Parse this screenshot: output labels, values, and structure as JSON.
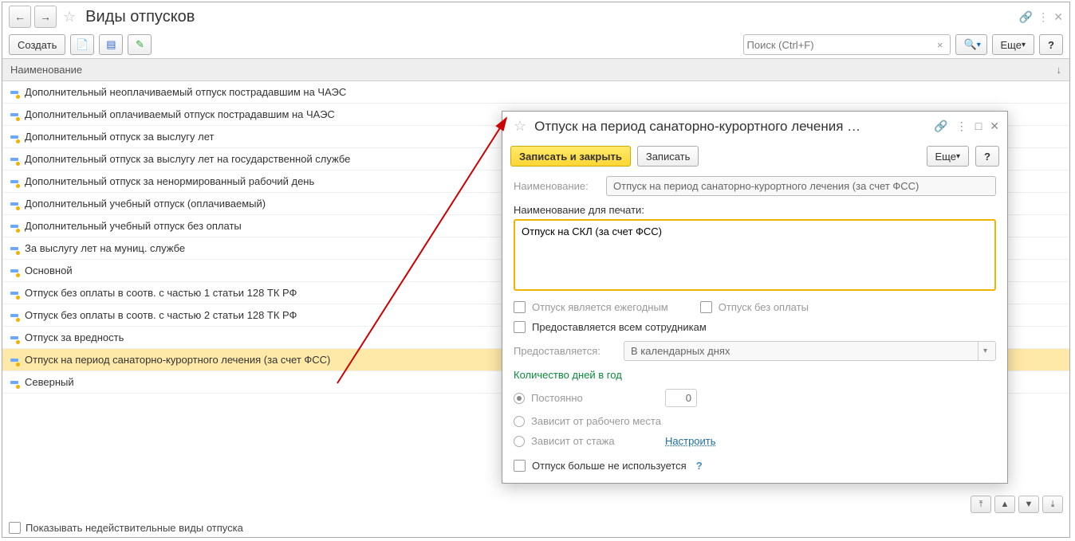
{
  "header": {
    "title": "Виды отпусков"
  },
  "toolbar": {
    "create": "Создать",
    "more": "Еще",
    "help": "?"
  },
  "search": {
    "placeholder": "Поиск (Ctrl+F)"
  },
  "table": {
    "header": "Наименование"
  },
  "list": [
    "Дополнительный неоплачиваемый отпуск пострадавшим на ЧАЭС",
    "Дополнительный оплачиваемый отпуск пострадавшим на ЧАЭС",
    "Дополнительный отпуск за выслугу лет",
    "Дополнительный отпуск за выслугу лет на государственной службе",
    "Дополнительный отпуск за ненормированный рабочий день",
    "Дополнительный учебный отпуск (оплачиваемый)",
    "Дополнительный учебный отпуск без оплаты",
    "За выслугу лет на муниц. службе",
    "Основной",
    "Отпуск без оплаты в соотв. с частью 1 статьи 128 ТК РФ",
    "Отпуск без оплаты в соотв. с частью 2 статьи 128 ТК РФ",
    "Отпуск за вредность",
    "Отпуск на период санаторно-курортного лечения (за счет ФСС)",
    "Северный"
  ],
  "selected_index": 12,
  "footer": {
    "show_inactive": "Показывать недействительные виды отпуска"
  },
  "dialog": {
    "title": "Отпуск на период санаторно-курортного лечения …",
    "save_close": "Записать и закрыть",
    "save": "Записать",
    "more": "Еще",
    "help": "?",
    "name_label": "Наименование:",
    "name_value": "Отпуск на период санаторно-курортного лечения (за счет ФСС)",
    "print_name_label": "Наименование для печати:",
    "print_name_value": "Отпуск на СКЛ (за счет ФСС)",
    "is_annual": "Отпуск является ежегодным",
    "no_pay": "Отпуск без оплаты",
    "all_employees": "Предоставляется всем сотрудникам",
    "provided_label": "Предоставляется:",
    "provided_value": "В календарных днях",
    "days_section": "Количество дней в год",
    "radio_const": "Постоянно",
    "radio_const_value": "0",
    "radio_workplace": "Зависит от рабочего места",
    "radio_stage": "Зависит от стажа",
    "configure": "Настроить",
    "not_used": "Отпуск больше не используется"
  }
}
